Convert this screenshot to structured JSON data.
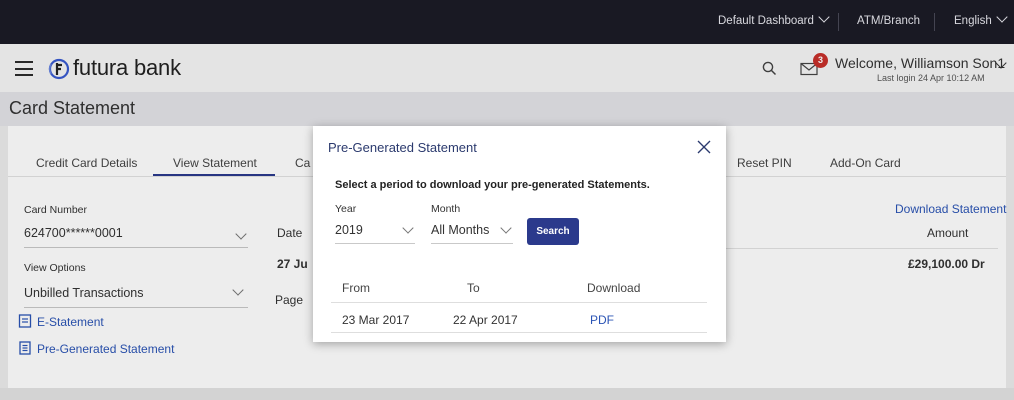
{
  "topbar": {
    "dashboard": "Default Dashboard",
    "atm_branch": "ATM/Branch",
    "language": "English"
  },
  "header": {
    "brand": "futura bank",
    "notification_count": "3",
    "welcome": "Welcome, Williamson Son1",
    "last_login": "Last login 24 Apr 10:12 AM"
  },
  "page_title": "Card Statement",
  "tabs": [
    {
      "label": "Credit Card Details"
    },
    {
      "label": "View Statement",
      "active": true
    },
    {
      "label": "Ca"
    },
    {
      "label": "Reset PIN"
    },
    {
      "label": "Add-On Card"
    }
  ],
  "card_number": {
    "label": "Card Number",
    "value": "624700******0001"
  },
  "view_options": {
    "label": "View Options",
    "value": "Unbilled Transactions"
  },
  "links": {
    "e_statement": "E-Statement",
    "pre_generated": "Pre-Generated Statement",
    "download_statement": "Download Statement"
  },
  "background_table": {
    "date_header": "Date",
    "amount_header": "Amount",
    "row_date": "27 Ju",
    "row_amount": "£29,100.00 Dr",
    "page_label": "Page"
  },
  "modal": {
    "title": "Pre-Generated Statement",
    "instruction": "Select a period to download your pre-generated Statements.",
    "year_label": "Year",
    "year_value": "2019",
    "month_label": "Month",
    "month_value": "All Months",
    "search_button": "Search",
    "columns": [
      "From",
      "To",
      "Download"
    ],
    "rows": [
      {
        "from": "23 Mar 2017",
        "to": "22 Apr 2017",
        "download": "PDF"
      }
    ]
  },
  "colors": {
    "topbar_bg": "#1b1b26",
    "primary": "#2b3a8c",
    "link": "#2b54b5",
    "badge": "#c8302b",
    "logo_blue": "#3a5bd0"
  }
}
